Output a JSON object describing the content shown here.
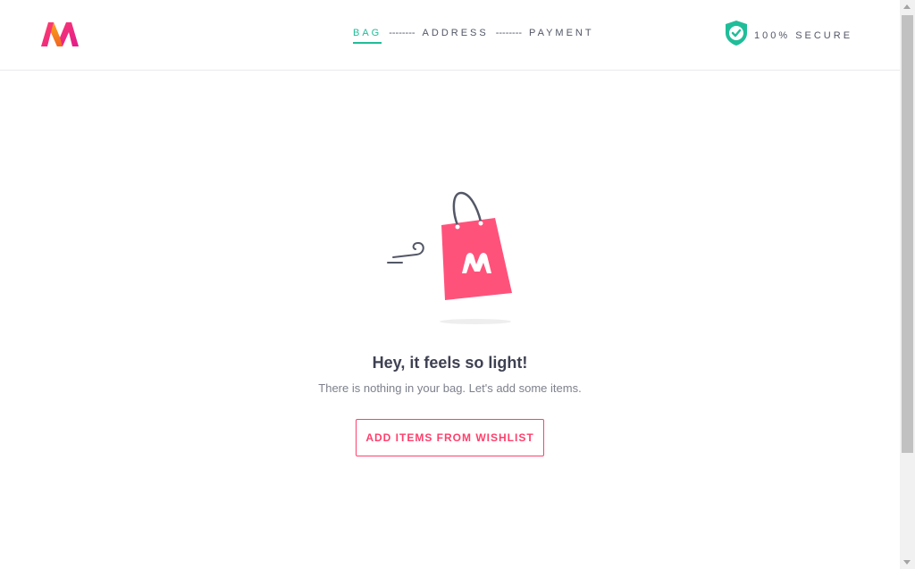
{
  "header": {
    "logo": "myntra-logo",
    "steps": [
      {
        "label": "BAG",
        "active": true
      },
      {
        "label": "ADDRESS",
        "active": false
      },
      {
        "label": "PAYMENT",
        "active": false
      }
    ],
    "step_divider": "--------",
    "secure_icon": "shield-check-icon",
    "secure_label": "100% SECURE"
  },
  "empty_bag": {
    "illustration": "shopping-bag-icon",
    "title": "Hey, it feels so light!",
    "subtitle": "There is nothing in your bag. Let's add some items.",
    "button_label": "ADD ITEMS FROM WISHLIST"
  },
  "colors": {
    "accent": "#ff3f6c",
    "active_step": "#20bd99",
    "text_dark": "#3e4152",
    "text_muted": "#7e818c"
  }
}
